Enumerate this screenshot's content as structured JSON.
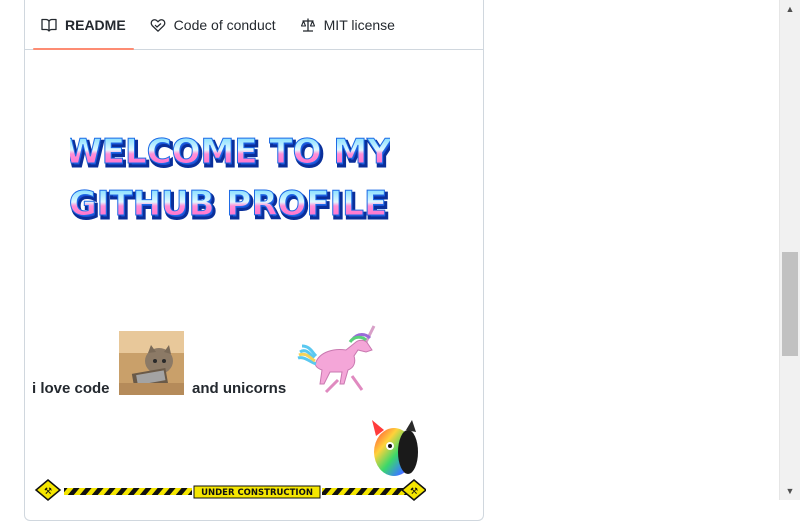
{
  "tabs": [
    {
      "label": "README",
      "icon": "book-icon",
      "active": true
    },
    {
      "label": "Code of conduct",
      "icon": "heart-handshake-icon",
      "active": false
    },
    {
      "label": "MIT license",
      "icon": "scale-icon",
      "active": false
    }
  ],
  "banner": {
    "line1": "WELCOME TO MY",
    "line2": "GITHUB PROFILE"
  },
  "content": {
    "text1": "i love code",
    "text2": "and unicorns"
  },
  "construction": {
    "label": "UNDER CONSTRUCTION"
  },
  "colors": {
    "tab_active_underline": "#fd8c73",
    "border": "#d0d7de"
  }
}
